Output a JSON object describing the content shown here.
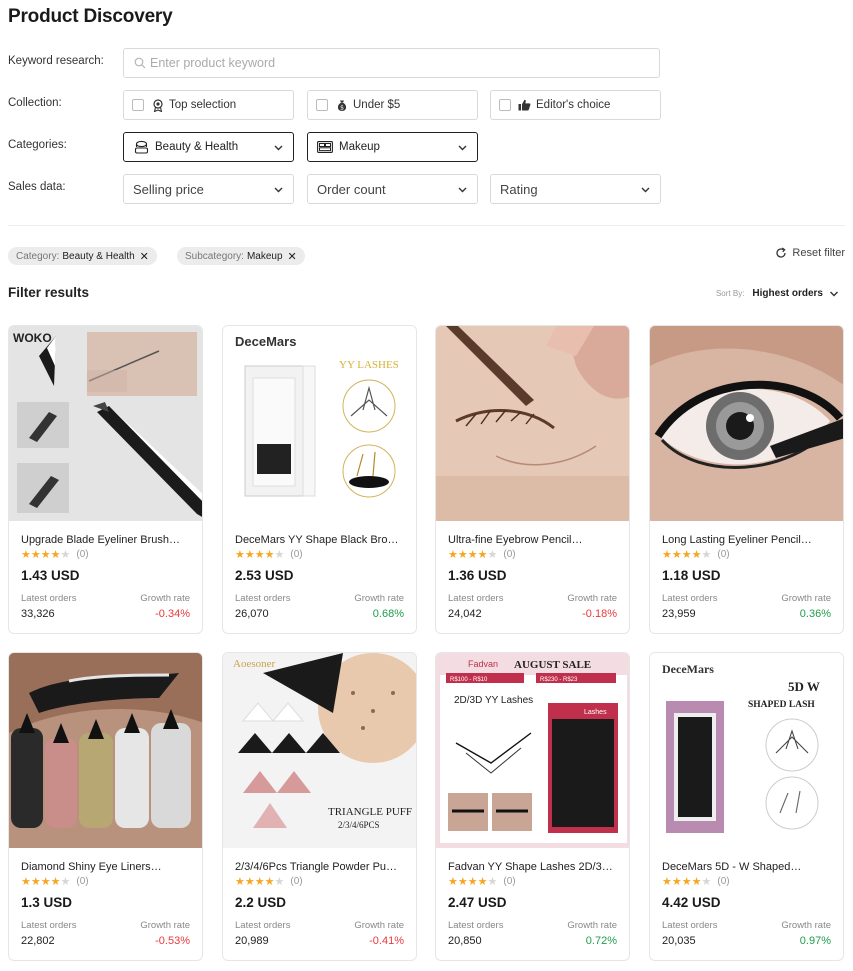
{
  "page": {
    "title": "Product Discovery"
  },
  "filters": {
    "keyword_label": "Keyword research:",
    "keyword_placeholder": "Enter product keyword",
    "keyword_value": "",
    "collection_label": "Collection:",
    "collection_options": [
      {
        "label": "Top selection",
        "icon": "award-icon",
        "checked": false
      },
      {
        "label": "Under $5",
        "icon": "money-bag-icon",
        "checked": false
      },
      {
        "label": "Editor's choice",
        "icon": "thumbs-up-icon",
        "checked": false
      }
    ],
    "categories_label": "Categories:",
    "category": {
      "value": "Beauty & Health",
      "icon": "cosmetics-icon"
    },
    "subcategory": {
      "value": "Makeup",
      "icon": "makeup-palette-icon"
    },
    "sales_label": "Sales data:",
    "sales_selects": [
      "Selling price",
      "Order count",
      "Rating"
    ]
  },
  "active_filters": [
    {
      "key": "Category:",
      "value": "Beauty & Health"
    },
    {
      "key": "Subcategory:",
      "value": "Makeup"
    }
  ],
  "reset_label": "Reset filter",
  "results": {
    "title": "Filter results",
    "sort_label": "Sort By:",
    "sort_value": "Highest orders"
  },
  "products": [
    {
      "name": "Upgrade Blade Eyeliner Brush…",
      "rating": 4,
      "reviews": "(0)",
      "price": "1.43 USD",
      "orders_label": "Latest orders",
      "orders": "33,326",
      "growth_label": "Growth rate",
      "growth": "-0.34%",
      "trend": "neg",
      "brand": "WOKO"
    },
    {
      "name": "DeceMars YY Shape Black Brow…",
      "rating": 4,
      "reviews": "(0)",
      "price": "2.53 USD",
      "orders_label": "Latest orders",
      "orders": "26,070",
      "growth_label": "Growth rate",
      "growth": "0.68%",
      "trend": "pos",
      "brand": "DeceMars",
      "tagline": "YY LASHES"
    },
    {
      "name": "Ultra-fine Eyebrow Pencil…",
      "rating": 4,
      "reviews": "(0)",
      "price": "1.36 USD",
      "orders_label": "Latest orders",
      "orders": "24,042",
      "growth_label": "Growth rate",
      "growth": "-0.18%",
      "trend": "neg"
    },
    {
      "name": "Long Lasting Eyeliner Pencil…",
      "rating": 4,
      "reviews": "(0)",
      "price": "1.18 USD",
      "orders_label": "Latest orders",
      "orders": "23,959",
      "growth_label": "Growth rate",
      "growth": "0.36%",
      "trend": "pos"
    },
    {
      "name": "Diamond Shiny Eye Liners…",
      "rating": 4,
      "reviews": "(0)",
      "price": "1.3 USD",
      "orders_label": "Latest orders",
      "orders": "22,802",
      "growth_label": "Growth rate",
      "growth": "-0.53%",
      "trend": "neg"
    },
    {
      "name": "2/3/4/6Pcs Triangle Powder Pu…",
      "rating": 4,
      "reviews": "(0)",
      "price": "2.2 USD",
      "orders_label": "Latest orders",
      "orders": "20,989",
      "growth_label": "Growth rate",
      "growth": "-0.41%",
      "trend": "neg",
      "brand": "Aoesoner",
      "tagline": "TRIANGLE PUFF",
      "sub": "2/3/4/6PCS"
    },
    {
      "name": "Fadvan YY Shape Lashes 2D/3…",
      "rating": 4,
      "reviews": "(0)",
      "price": "2.47 USD",
      "orders_label": "Latest orders",
      "orders": "20,850",
      "growth_label": "Growth rate",
      "growth": "0.72%",
      "trend": "pos",
      "brand": "Fadvan",
      "tagline": "AUGUST SALE",
      "sub": "2D/3D YY Lashes",
      "promo1": "R$100 - R$10",
      "promo2": "R$230 - R$23",
      "box_label": "Lashes"
    },
    {
      "name": "DeceMars 5D - W Shaped…",
      "rating": 4,
      "reviews": "(0)",
      "price": "4.42 USD",
      "orders_label": "Latest orders",
      "orders": "20,035",
      "growth_label": "Growth rate",
      "growth": "0.97%",
      "trend": "pos",
      "brand": "DeceMars",
      "tagline": "5D W",
      "sub": "SHAPED LASH"
    }
  ],
  "colors": {
    "negative": "#e8383d",
    "positive": "#1f9d4c",
    "star": "#f5a623"
  }
}
